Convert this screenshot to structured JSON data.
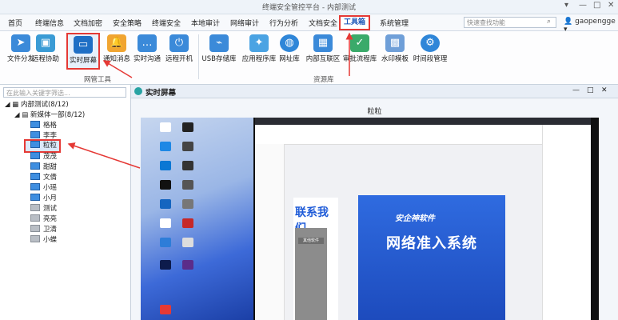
{
  "window": {
    "title": "终端安全管控平台 - 内部测试"
  },
  "menu": [
    "首页",
    "终端信息",
    "文档加密",
    "安全策略",
    "终端安全",
    "本地审计",
    "网络审计",
    "行为分析",
    "文档安全",
    "工具箱",
    "系统管理"
  ],
  "active_menu_index": 9,
  "search": {
    "placeholder": "快速查找功能"
  },
  "user": {
    "name": "gaopengge"
  },
  "toolbar": {
    "group1": {
      "label": "网管工具",
      "tools": [
        "文件分发",
        "远程协助",
        "实时屏幕",
        "通知消息",
        "实时沟通",
        "远程开机"
      ]
    },
    "group2": {
      "label": "资源库",
      "tools": [
        "USB存储库",
        "应用程序库",
        "网址库",
        "内部互联区",
        "审批流程库",
        "水印模板",
        "时间段管理"
      ]
    },
    "selected_tool": "实时屏幕"
  },
  "tree": {
    "filter_placeholder": "在此输入关键字筛选...",
    "root": "内部测试(8/12)",
    "group": "新媒体一部(8/12)",
    "members": [
      "格格",
      "李李",
      "粒粒",
      "茂茂",
      "甜甜",
      "文倩",
      "小瑶",
      "小月",
      "测试",
      "亮亮",
      "卫清",
      "小蝶"
    ],
    "offline": [
      8,
      9,
      10,
      11
    ],
    "selected": "粒粒"
  },
  "pane": {
    "title": "实时屏幕",
    "screen_user": "粒粒",
    "controls": [
      "—",
      "□",
      "✕"
    ]
  },
  "screenshot": {
    "headline": "联系我们",
    "gray_panel_title": "其他软件",
    "brand": "安企神软件",
    "banner_text": "网络准入系统"
  },
  "colors": {
    "accent": "#1a56b8",
    "highlight": "#e53935",
    "online": "#3e8ee0"
  },
  "icons": [
    "search-icon",
    "user-icon",
    "tree-expand-icon",
    "monitor-icon",
    "screen-icon"
  ]
}
